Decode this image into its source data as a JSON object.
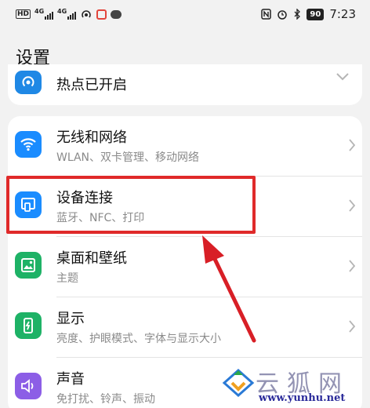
{
  "status_bar": {
    "hd": "HD",
    "sim1": "4G",
    "sim2": "4G",
    "battery": "90",
    "time": "7:23"
  },
  "page_title": "设置",
  "partial_item": {
    "title": "热点已开启"
  },
  "items": [
    {
      "title": "无线和网络",
      "subtitle": "WLAN、双卡管理、移动网络",
      "icon": "wifi-icon",
      "color": "#1a8cff"
    },
    {
      "title": "设备连接",
      "subtitle": "蓝牙、NFC、打印",
      "icon": "device-connection-icon",
      "color": "#1a8cff"
    },
    {
      "title": "桌面和壁纸",
      "subtitle": "主题",
      "icon": "wallpaper-icon",
      "color": "#1eb266"
    },
    {
      "title": "显示",
      "subtitle": "亮度、护眼模式、字体与显示大小",
      "icon": "display-icon",
      "color": "#1eb266"
    },
    {
      "title": "声音",
      "subtitle": "免打扰、铃声、振动",
      "icon": "sound-icon",
      "color": "#8c5ee6"
    }
  ],
  "watermark": {
    "text": "云狐网",
    "url": "www.yunhu.net"
  },
  "colors": {
    "highlight": "#e02a2a",
    "arrow": "#d81f26"
  }
}
